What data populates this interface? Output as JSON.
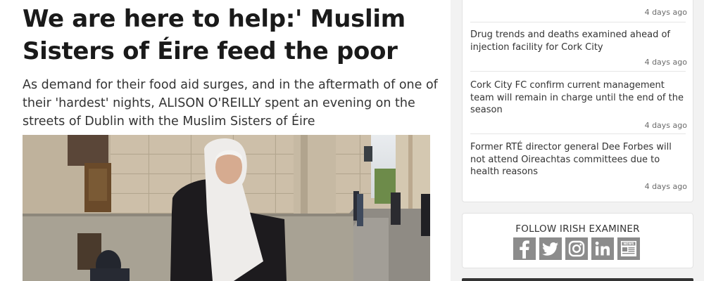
{
  "article": {
    "headline": "We are here to help:' Muslim Sisters of Éire feed the poor",
    "standfirst": "As demand for their food aid surges, and in the aftermath of one of their 'hardest' nights, ALISON O'REILLY spent an evening on the streets of Dublin with the Muslim Sisters of Éire"
  },
  "sidebar": {
    "stories": [
      {
        "title": "",
        "ago": "4 days ago"
      },
      {
        "title": "Drug trends and deaths examined ahead of injection facility for Cork City",
        "ago": "4 days ago"
      },
      {
        "title": "Cork City FC confirm current management team will remain in charge until the end of the season",
        "ago": "4 days ago"
      },
      {
        "title": "Former RTÉ director general Dee Forbes will not attend Oireachtas committees due to health reasons",
        "ago": "4 days ago"
      }
    ],
    "follow": {
      "title": "FOLLOW IRISH EXAMINER",
      "icons": [
        "facebook-icon",
        "twitter-icon",
        "instagram-icon",
        "linkedin-icon",
        "news-icon"
      ],
      "news_label": "NEWS"
    }
  },
  "colors": {
    "icon_bg": "#8c8c8c",
    "text": "#333333",
    "headline": "#1a1a1a"
  }
}
